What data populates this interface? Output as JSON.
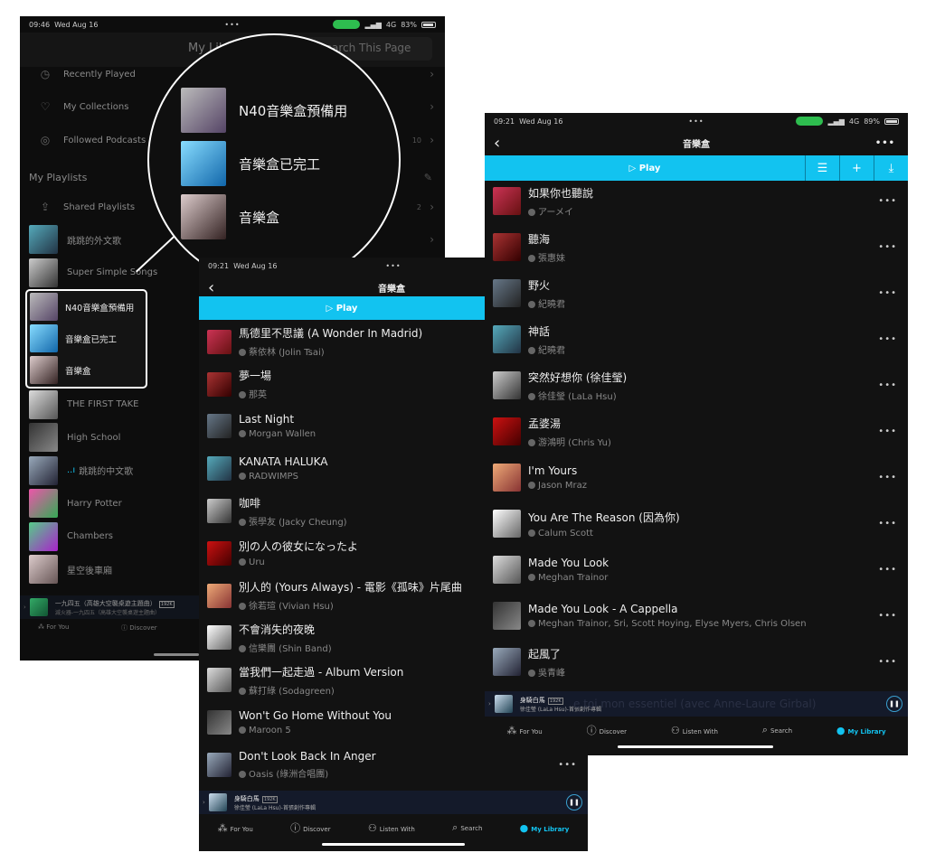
{
  "left": {
    "status": {
      "time": "09:46",
      "date": "Wed Aug 16",
      "battery": "83%",
      "network": "4G",
      "battery_fraction": 0.83
    },
    "header": {
      "title": "My Library",
      "search_placeholder": "Search This Page"
    },
    "menu": [
      {
        "label": "Recently Played",
        "icon": "clock-icon",
        "count": ""
      },
      {
        "label": "My Collections",
        "icon": "heart-icon",
        "count": ""
      },
      {
        "label": "Followed Podcasts",
        "icon": "podcast-icon",
        "count": "10"
      }
    ],
    "playlists_title": "My Playlists",
    "shared": {
      "label": "Shared Playlists",
      "count": "2"
    },
    "playlists": [
      "跳跳的外文歌",
      "Super Simple Songs",
      "N40音樂盒預備用",
      "音樂盒已完工",
      "音樂盒",
      "THE FIRST TAKE",
      "High School",
      "跳跳的中文歌",
      "Harry Potter",
      "Chambers",
      "星空後車廂"
    ],
    "mini": {
      "title": "一九四五（高雄大空襲桌遊主題曲）",
      "subtitle": "滅火器-一九四五（高雄大空襲桌遊主題曲）",
      "quality": "192K"
    },
    "tabs": [
      "For You",
      "Discover"
    ],
    "zoom_items": [
      "N40音樂盒預備用",
      "音樂盒已完工",
      "音樂盒"
    ]
  },
  "mid": {
    "status": {
      "time": "09:21",
      "date": "Wed Aug 16"
    },
    "title": "音樂盒",
    "play": "Play",
    "songs": [
      {
        "title": "馬德里不思議 (A Wonder In Madrid)",
        "artist": "蔡依林 (Jolin Tsai)"
      },
      {
        "title": "夢一場",
        "artist": "那英"
      },
      {
        "title": "Last Night",
        "artist": "Morgan Wallen"
      },
      {
        "title": "KANATA HALUKA",
        "artist": "RADWIMPS"
      },
      {
        "title": "咖啡",
        "artist": "張學友 (Jacky Cheung)"
      },
      {
        "title": "別の人の彼女になったよ",
        "artist": "Uru"
      },
      {
        "title": "別人的 (Yours Always) - 電影《孤味》片尾曲",
        "artist": "徐若瑄 (Vivian Hsu)"
      },
      {
        "title": "不會消失的夜晚",
        "artist": "信樂團 (Shin Band)"
      },
      {
        "title": "當我們一起走過 - Album Version",
        "artist": "蘇打綠 (Sodagreen)"
      },
      {
        "title": "Won't Go Home Without You",
        "artist": "Maroon 5"
      },
      {
        "title": "Don't Look Back In Anger",
        "artist": "Oasis (綠洲合唱團)"
      }
    ],
    "mini": {
      "title": "身騎白馬",
      "subtitle": "徐佳瑩 (LaLa Hsu)-首張創作專輯",
      "quality": "192K"
    },
    "tabs": [
      "For You",
      "Discover",
      "Listen With",
      "Search",
      "My Library"
    ]
  },
  "right": {
    "status": {
      "time": "09:21",
      "date": "Wed Aug 16",
      "battery": "89%",
      "network": "4G",
      "battery_fraction": 0.89
    },
    "title": "音樂盒",
    "play": "Play",
    "songs": [
      {
        "title": "如果你也聽說",
        "artist": "アーメイ"
      },
      {
        "title": "聽海",
        "artist": "張惠妹"
      },
      {
        "title": "野火",
        "artist": "紀曉君"
      },
      {
        "title": "神話",
        "artist": "紀曉君"
      },
      {
        "title": "突然好想你 (徐佳瑩)",
        "artist": "徐佳瑩 (LaLa Hsu)"
      },
      {
        "title": "孟婆湯",
        "artist": "游鴻明 (Chris Yu)"
      },
      {
        "title": "I'm Yours",
        "artist": "Jason Mraz"
      },
      {
        "title": "You Are The Reason (因為你)",
        "artist": "Calum Scott"
      },
      {
        "title": "Made You Look",
        "artist": "Meghan Trainor"
      },
      {
        "title": "Made You Look - A Cappella",
        "artist": "Meghan Trainor, Sri, Scott Hoying, Elyse Myers, Chris Olsen"
      },
      {
        "title": "起風了",
        "artist": "吳青峰"
      }
    ],
    "mini": {
      "title": "身騎白馬",
      "subtitle": "徐佳瑩 (LaLa Hsu)-首張創作專輯",
      "quality": "192K",
      "ghost": "e toi mon essentiel (avec Anne-Laure Girbal)"
    },
    "tabs": [
      "For You",
      "Discover",
      "Listen With",
      "Search",
      "My Library"
    ]
  },
  "colors": {
    "accent": "#12c3f0",
    "background": "#121212",
    "status_pill": "#2ebd4f"
  }
}
